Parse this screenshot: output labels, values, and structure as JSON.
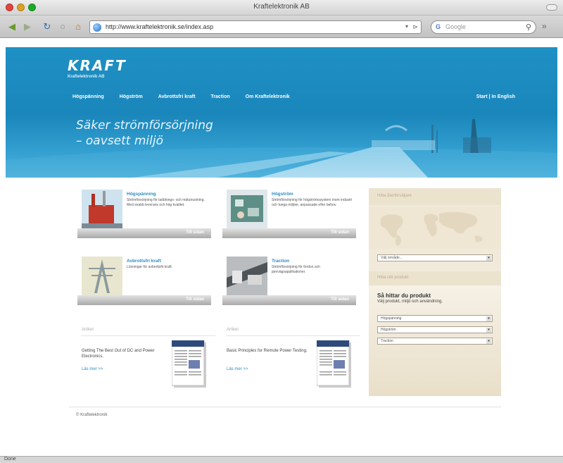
{
  "window": {
    "title": "Kraftelektronik AB"
  },
  "toolbar": {
    "url": "http://www.kraftelektronik.se/index.asp",
    "search_placeholder": "Google",
    "search_engine_glyph": "G"
  },
  "header": {
    "logo": "KRAFT",
    "logo_sub": "Kraftelektronik AB",
    "nav": [
      "Högspänning",
      "Högström",
      "Avbrottsfri kraft",
      "Traction",
      "Om Kraftelektronik"
    ],
    "lang": "Start  |  In English",
    "tagline_line1": "Säker strömförsörjning",
    "tagline_line2": "– oavsett miljö"
  },
  "cards": [
    {
      "title": "Högspänning",
      "desc": "Strömförsörjning för laddnings- och mätutrustning. Med snabb leverans och hög kvalitet.",
      "more": "Till sidan"
    },
    {
      "title": "Högström",
      "desc": "Strömförsörjning för högströmssystem inom industri och tunga miljöer, anpassade efter behov.",
      "more": "Till sidan"
    },
    {
      "title": "Avbrottsfri kraft",
      "desc": "Lösningar för avbrottsfri kraft.",
      "more": "Till sidan"
    },
    {
      "title": "Traction",
      "desc": "Strömförsörjning för fordon och järnvägsapplikationer.",
      "more": "Till sidan"
    }
  ],
  "articles": [
    {
      "head": "Artikel",
      "text": "Getting The Best Out of DC and Power Electronics.",
      "link": "Läs mer >>"
    },
    {
      "head": "Artikel",
      "text": "Basic Principles for Remote Power Testing.",
      "link": "Läs mer >>"
    }
  ],
  "panel": {
    "head": "Hitta återförsäljare",
    "region_select": "Välj område...",
    "sub_head": "Hitta rätt produkt",
    "title": "Så hittar du produkt",
    "subtitle": "Välj produkt, miljö och användning.",
    "selects": [
      "Högspänning",
      "Högström",
      "Traction"
    ]
  },
  "footer": {
    "copyright": "© Kraftelektronik"
  },
  "status": {
    "text": "Done"
  },
  "colors": {
    "banner_blue": "#1f90c4",
    "link_blue": "#2b8cc4",
    "panel_beige": "#f1eadb"
  }
}
